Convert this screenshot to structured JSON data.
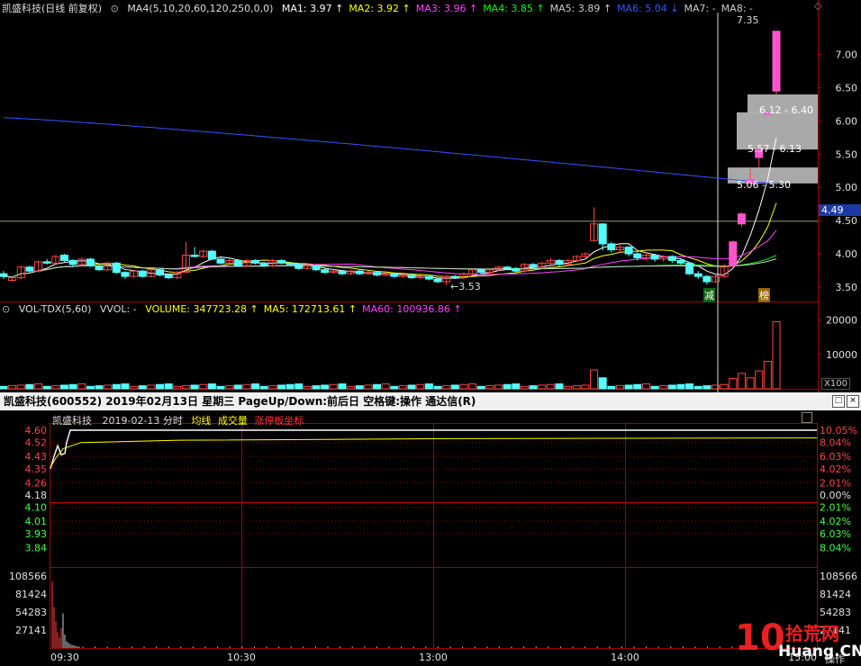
{
  "kline_header": {
    "name_label": "凯盛科技(日线 前复权)",
    "ma_params": "MA4(5,10,20,60,120,250,0,0)",
    "ma_items": [
      {
        "label": "MA1: 3.97",
        "arrow": "↑",
        "color": "#ffffff"
      },
      {
        "label": "MA2: 3.92",
        "arrow": "↑",
        "color": "#ffff00"
      },
      {
        "label": "MA3: 3.96",
        "arrow": "↑",
        "color": "#ff44ff"
      },
      {
        "label": "MA4: 3.85",
        "arrow": "↑",
        "color": "#00ff00"
      },
      {
        "label": "MA5: 3.89",
        "arrow": "↑",
        "color": "#cccccc"
      },
      {
        "label": "MA6: 5.04",
        "arrow": "↓",
        "color": "#3355ff"
      },
      {
        "label": "MA7: -",
        "arrow": "",
        "color": "#cccccc"
      },
      {
        "label": "MA8: -",
        "arrow": "",
        "color": "#cccccc"
      }
    ]
  },
  "vol_header": {
    "name_label": "VOL-TDX(5,60)",
    "vvol_label": "VVOL: -",
    "items": [
      {
        "label": "VOLUME: 347723.28",
        "arrow": "↑",
        "color": "#ffff00"
      },
      {
        "label": "MA5: 172713.61",
        "arrow": "↑",
        "color": "#ffff00"
      },
      {
        "label": "MA60: 100936.86",
        "arrow": "↑",
        "color": "#ff44ff"
      }
    ]
  },
  "intraday_panel": {
    "title_bar": "凯盛科技(600552)  2019年02月13日 星期三  PageUp/Down:前后日  空格键:操作  通达信(R)",
    "stock_label": "凯盛科技",
    "date_label": "2019-02-13 分时",
    "legend": [
      {
        "label": "均线",
        "color": "#ffff00"
      },
      {
        "label": "成交量",
        "color": "#ffff00"
      },
      {
        "label": "涨停板坐标",
        "color": "#ff3333"
      }
    ],
    "operate_label": "操作"
  },
  "annotations": {
    "cur_price_tag": "4.49",
    "high_label": "7.35",
    "low_label": "3.53",
    "gap_labels": [
      "6.12 - 6.40",
      "5.57 - 6.13",
      "5.06 - 5.30"
    ],
    "marker_jian": "减",
    "marker_bang": "榜"
  },
  "watermark": {
    "num": "10",
    "cn": "拾荒网",
    "en": "Huang.CN"
  },
  "chart_data": [
    {
      "type": "candlestick",
      "name": "daily-kline",
      "y_ticks": [
        3.5,
        4.0,
        4.5,
        5.0,
        5.5,
        6.0,
        6.5,
        7.0
      ],
      "y_tick_labels": [
        "3.50",
        "4.00",
        "4.50",
        "5.00",
        "5.50",
        "6.00",
        "6.50",
        "7.00"
      ],
      "ylim": [
        3.35,
        7.55
      ],
      "grid": false,
      "candles": [
        [
          3.7,
          3.66,
          3.74,
          3.62
        ],
        [
          3.6,
          3.64,
          3.66,
          3.58
        ],
        [
          3.64,
          3.8,
          3.82,
          3.62
        ],
        [
          3.8,
          3.74,
          3.82,
          3.72
        ],
        [
          3.74,
          3.88,
          3.9,
          3.72
        ],
        [
          3.88,
          3.86,
          3.92,
          3.84
        ],
        [
          3.86,
          3.96,
          3.98,
          3.84
        ],
        [
          3.98,
          3.9,
          4.0,
          3.88
        ],
        [
          3.9,
          3.84,
          3.92,
          3.8
        ],
        [
          3.84,
          3.92,
          3.94,
          3.82
        ],
        [
          3.92,
          3.82,
          3.94,
          3.8
        ],
        [
          3.82,
          3.76,
          3.84,
          3.74
        ],
        [
          3.76,
          3.86,
          3.88,
          3.74
        ],
        [
          3.86,
          3.72,
          3.88,
          3.7
        ],
        [
          3.72,
          3.66,
          3.74,
          3.62
        ],
        [
          3.66,
          3.74,
          3.76,
          3.64
        ],
        [
          3.74,
          3.66,
          3.76,
          3.64
        ],
        [
          3.66,
          3.76,
          3.78,
          3.64
        ],
        [
          3.76,
          3.68,
          3.78,
          3.66
        ],
        [
          3.68,
          3.64,
          3.7,
          3.62
        ],
        [
          3.64,
          3.72,
          3.74,
          3.62
        ],
        [
          3.72,
          3.98,
          4.18,
          3.72
        ],
        [
          3.98,
          3.96,
          4.1,
          3.94
        ],
        [
          3.96,
          4.04,
          4.06,
          3.94
        ],
        [
          4.04,
          3.92,
          4.06,
          3.9
        ],
        [
          3.92,
          3.86,
          3.94,
          3.84
        ],
        [
          3.86,
          3.9,
          3.92,
          3.84
        ],
        [
          3.9,
          3.82,
          3.92,
          3.8
        ],
        [
          3.82,
          3.9,
          3.92,
          3.8
        ],
        [
          3.9,
          3.86,
          3.92,
          3.84
        ],
        [
          3.86,
          3.82,
          3.88,
          3.8
        ],
        [
          3.82,
          3.9,
          3.92,
          3.8
        ],
        [
          3.9,
          3.86,
          3.92,
          3.84
        ],
        [
          3.86,
          3.84,
          3.88,
          3.82
        ],
        [
          3.84,
          3.78,
          3.86,
          3.76
        ],
        [
          3.78,
          3.82,
          3.84,
          3.76
        ],
        [
          3.82,
          3.76,
          3.84,
          3.74
        ],
        [
          3.76,
          3.72,
          3.78,
          3.7
        ],
        [
          3.72,
          3.74,
          3.78,
          3.7
        ],
        [
          3.74,
          3.7,
          3.76,
          3.68
        ],
        [
          3.7,
          3.74,
          3.76,
          3.68
        ],
        [
          3.74,
          3.7,
          3.76,
          3.68
        ],
        [
          3.7,
          3.72,
          3.74,
          3.68
        ],
        [
          3.72,
          3.68,
          3.74,
          3.66
        ],
        [
          3.68,
          3.7,
          3.72,
          3.66
        ],
        [
          3.7,
          3.66,
          3.72,
          3.64
        ],
        [
          3.66,
          3.68,
          3.7,
          3.64
        ],
        [
          3.68,
          3.64,
          3.7,
          3.62
        ],
        [
          3.64,
          3.66,
          3.68,
          3.62
        ],
        [
          3.66,
          3.62,
          3.68,
          3.6
        ],
        [
          3.62,
          3.58,
          3.64,
          3.56
        ],
        [
          3.58,
          3.66,
          3.68,
          3.53
        ],
        [
          3.66,
          3.64,
          3.68,
          3.62
        ],
        [
          3.64,
          3.7,
          3.72,
          3.62
        ],
        [
          3.7,
          3.76,
          3.78,
          3.68
        ],
        [
          3.76,
          3.72,
          3.78,
          3.7
        ],
        [
          3.72,
          3.76,
          3.78,
          3.7
        ],
        [
          3.76,
          3.8,
          3.82,
          3.74
        ],
        [
          3.8,
          3.78,
          3.82,
          3.76
        ],
        [
          3.78,
          3.74,
          3.8,
          3.72
        ],
        [
          3.74,
          3.84,
          3.86,
          3.72
        ],
        [
          3.84,
          3.8,
          3.86,
          3.78
        ],
        [
          3.8,
          3.86,
          3.88,
          3.78
        ],
        [
          3.86,
          3.9,
          3.94,
          3.84
        ],
        [
          3.9,
          3.84,
          3.92,
          3.8
        ],
        [
          3.84,
          3.9,
          3.92,
          3.82
        ],
        [
          3.9,
          3.96,
          3.98,
          3.88
        ],
        [
          3.96,
          4.0,
          4.02,
          3.94
        ],
        [
          4.2,
          4.45,
          4.7,
          4.18
        ],
        [
          4.45,
          4.15,
          4.46,
          4.05
        ],
        [
          4.15,
          4.06,
          4.18,
          4.02
        ],
        [
          4.06,
          4.1,
          4.14,
          4.02
        ],
        [
          4.1,
          4.0,
          4.12,
          3.96
        ],
        [
          4.0,
          3.94,
          4.04,
          3.9
        ],
        [
          3.94,
          3.98,
          4.02,
          3.9
        ],
        [
          3.98,
          3.92,
          4.0,
          3.88
        ],
        [
          3.92,
          3.96,
          3.98,
          3.88
        ],
        [
          3.96,
          3.9,
          3.98,
          3.86
        ],
        [
          3.9,
          3.86,
          3.92,
          3.84
        ],
        [
          3.86,
          3.7,
          3.88,
          3.68
        ],
        [
          3.7,
          3.66,
          3.74,
          3.62
        ],
        [
          3.66,
          3.58,
          3.68,
          3.54
        ],
        [
          3.58,
          3.66,
          3.7,
          3.56
        ],
        [
          3.66,
          3.82,
          3.84,
          3.64
        ],
        [
          3.82,
          4.18,
          4.2,
          3.8
        ],
        [
          4.45,
          4.6,
          4.62,
          4.4
        ],
        [
          5.06,
          5.12,
          5.3,
          5.06
        ],
        [
          5.45,
          5.57,
          5.62,
          5.3
        ],
        [
          6.1,
          6.12,
          6.16,
          6.1
        ],
        [
          6.45,
          7.35,
          7.35,
          6.4
        ]
      ],
      "ma_series": [
        {
          "name": "MA1",
          "color": "#ffffff"
        },
        {
          "name": "MA2",
          "color": "#ffff00"
        },
        {
          "name": "MA3",
          "color": "#ff44ff"
        },
        {
          "name": "MA4",
          "color": "#00ff00"
        },
        {
          "name": "MA5",
          "color": "#cccccc"
        },
        {
          "name": "MA6",
          "color": "#3355ff"
        }
      ]
    },
    {
      "type": "bar",
      "name": "daily-volume",
      "y_ticks": [
        10000,
        20000
      ],
      "y_tick_labels": [
        "10000",
        "20000"
      ],
      "unit_label": "X100",
      "ylim": [
        0,
        22000
      ]
    },
    {
      "type": "line",
      "name": "intraday-price",
      "x_ticks": [
        "09:30",
        "10:30",
        "13:00",
        "14:00",
        "15:00"
      ],
      "y_ticks": [
        3.84,
        3.93,
        4.01,
        4.1,
        4.18,
        4.26,
        4.35,
        4.43,
        4.52,
        4.6
      ],
      "y_tick_labels": [
        "3.84",
        "3.93",
        "4.01",
        "4.10",
        "4.18",
        "4.26",
        "4.35",
        "4.43",
        "4.52",
        "4.60"
      ],
      "pct_ticks": [
        "8.04%",
        "6.03%",
        "4.02%",
        "2.01%",
        "0.00%",
        "2.01%",
        "4.02%",
        "6.03%",
        "8.04%",
        "10.05%"
      ],
      "ylim": [
        3.76,
        4.6
      ],
      "prev_close": 4.18,
      "limit_up": 4.6,
      "price_path": [
        4.35,
        4.43,
        4.5,
        4.44,
        4.45,
        4.52,
        4.6,
        4.6
      ],
      "avg_value_end": 4.55
    },
    {
      "type": "bar",
      "name": "intraday-volume",
      "y_ticks": [
        27141,
        54283,
        81424,
        108566
      ],
      "y_tick_labels": [
        "27141",
        "54283",
        "81424",
        "108566"
      ],
      "ylim": [
        0,
        108566
      ]
    }
  ]
}
